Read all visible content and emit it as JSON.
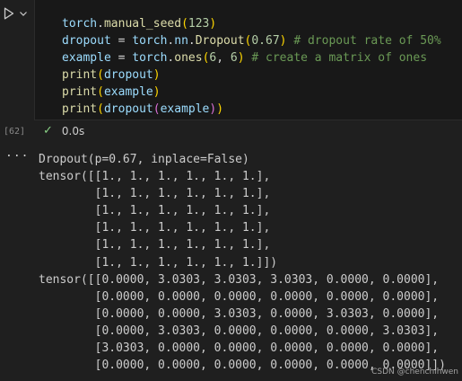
{
  "cell": {
    "code_lines": [
      [
        {
          "t": "torch",
          "k": "v"
        },
        {
          "t": ".",
          "k": "p"
        },
        {
          "t": "manual_seed",
          "k": "f"
        },
        {
          "t": "(",
          "k": "b1"
        },
        {
          "t": "123",
          "k": "n"
        },
        {
          "t": ")",
          "k": "b1"
        }
      ],
      [
        {
          "t": "dropout",
          "k": "v"
        },
        {
          "t": " = ",
          "k": "p"
        },
        {
          "t": "torch",
          "k": "v"
        },
        {
          "t": ".",
          "k": "p"
        },
        {
          "t": "nn",
          "k": "v"
        },
        {
          "t": ".",
          "k": "p"
        },
        {
          "t": "Dropout",
          "k": "f"
        },
        {
          "t": "(",
          "k": "b1"
        },
        {
          "t": "0.67",
          "k": "n"
        },
        {
          "t": ")",
          "k": "b1"
        },
        {
          "t": " # dropout rate of 50%",
          "k": "c"
        }
      ],
      [
        {
          "t": "example",
          "k": "v"
        },
        {
          "t": " = ",
          "k": "p"
        },
        {
          "t": "torch",
          "k": "v"
        },
        {
          "t": ".",
          "k": "p"
        },
        {
          "t": "ones",
          "k": "f"
        },
        {
          "t": "(",
          "k": "b1"
        },
        {
          "t": "6",
          "k": "n"
        },
        {
          "t": ", ",
          "k": "p"
        },
        {
          "t": "6",
          "k": "n"
        },
        {
          "t": ")",
          "k": "b1"
        },
        {
          "t": " # create a matrix of ones",
          "k": "c"
        }
      ],
      [
        {
          "t": "print",
          "k": "f"
        },
        {
          "t": "(",
          "k": "b1"
        },
        {
          "t": "dropout",
          "k": "v"
        },
        {
          "t": ")",
          "k": "b1"
        }
      ],
      [
        {
          "t": "print",
          "k": "f"
        },
        {
          "t": "(",
          "k": "b1"
        },
        {
          "t": "example",
          "k": "v"
        },
        {
          "t": ")",
          "k": "b1"
        }
      ],
      [
        {
          "t": "print",
          "k": "f"
        },
        {
          "t": "(",
          "k": "b1"
        },
        {
          "t": "dropout",
          "k": "v"
        },
        {
          "t": "(",
          "k": "b2"
        },
        {
          "t": "example",
          "k": "v"
        },
        {
          "t": ")",
          "k": "b2"
        },
        {
          "t": ")",
          "k": "b1"
        }
      ]
    ],
    "execution_count": "[62]",
    "duration": "0.0s",
    "run_icon": "play-icon",
    "menu_icon": "chevron-down-icon",
    "status_icon": "check-icon"
  },
  "output": {
    "more_label": "...",
    "lines": [
      "Dropout(p=0.67, inplace=False)",
      "tensor([[1., 1., 1., 1., 1., 1.],",
      "        [1., 1., 1., 1., 1., 1.],",
      "        [1., 1., 1., 1., 1., 1.],",
      "        [1., 1., 1., 1., 1., 1.],",
      "        [1., 1., 1., 1., 1., 1.],",
      "        [1., 1., 1., 1., 1., 1.]])",
      "tensor([[0.0000, 3.0303, 3.0303, 3.0303, 0.0000, 0.0000],",
      "        [0.0000, 0.0000, 0.0000, 0.0000, 0.0000, 0.0000],",
      "        [0.0000, 0.0000, 3.0303, 0.0000, 3.0303, 0.0000],",
      "        [0.0000, 3.0303, 0.0000, 0.0000, 0.0000, 3.0303],",
      "        [3.0303, 0.0000, 0.0000, 0.0000, 0.0000, 0.0000],",
      "        [0.0000, 0.0000, 0.0000, 0.0000, 0.0000, 0.0000]])"
    ]
  },
  "watermark": "CSDN @chenchihwen",
  "colors": {
    "background": "#1f1f1f",
    "editor_background": "#181818",
    "success": "#89d185"
  }
}
